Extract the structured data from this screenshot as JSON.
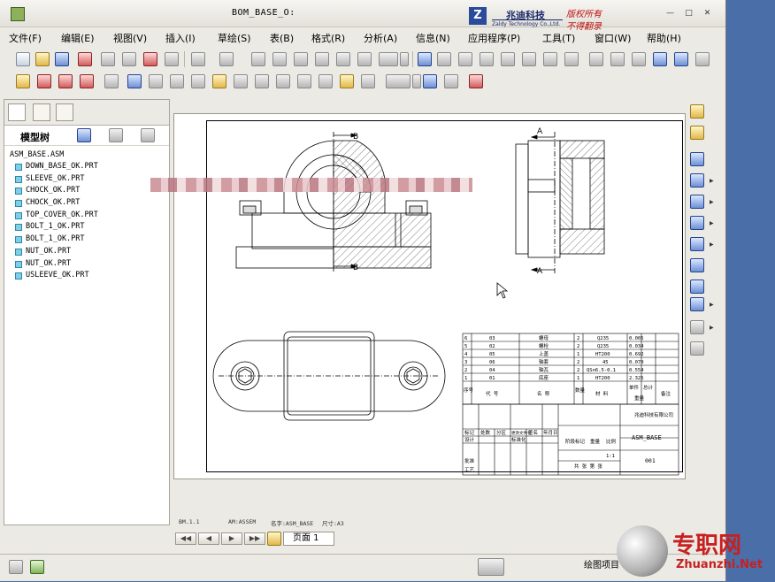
{
  "window": {
    "title": "BOM_BASE_O:",
    "minimize": "—",
    "maximize": "□",
    "close": "✕"
  },
  "watermark": {
    "logo": "Z",
    "name": "兆迪科技",
    "english": "Zaldy Technology Co.,Ltd.",
    "copyright": "版权所有",
    "no_copy": "不得翻录"
  },
  "menu": [
    {
      "label": "文件(F)"
    },
    {
      "label": "编辑(E)"
    },
    {
      "label": "视图(V)"
    },
    {
      "label": "插入(I)"
    },
    {
      "label": "草绘(S)"
    },
    {
      "label": "表(B)"
    },
    {
      "label": "格式(R)"
    },
    {
      "label": "分析(A)"
    },
    {
      "label": "信息(N)"
    },
    {
      "label": "应用程序(P)"
    },
    {
      "label": "工具(T)"
    },
    {
      "label": "窗口(W)"
    },
    {
      "label": "帮助(H)"
    }
  ],
  "model_tree": {
    "title": "模型树",
    "root": "ASM_BASE.ASM",
    "items": [
      "DOWN_BASE_OK.PRT",
      "SLEEVE_OK.PRT",
      "CHOCK_OK.PRT",
      "CHOCK_OK.PRT",
      "TOP_COVER_OK.PRT",
      "BOLT_1_OK.PRT",
      "BOLT_1_OK.PRT",
      "NUT_OK.PRT",
      "NUT_OK.PRT",
      "USLEEVE_OK.PRT"
    ]
  },
  "drawing": {
    "section_b": "B",
    "section_a": "A",
    "bom_rows": [
      {
        "no": "6",
        "code": "03",
        "name": "螺母",
        "qty": "2",
        "material": "Q235",
        "weight": "0.005"
      },
      {
        "no": "5",
        "code": "02",
        "name": "螺栓",
        "qty": "2",
        "material": "Q235",
        "weight": "0.034"
      },
      {
        "no": "4",
        "code": "05",
        "name": "上盖",
        "qty": "1",
        "material": "HT200",
        "weight": "0.692"
      },
      {
        "no": "3",
        "code": "06",
        "name": "轴套",
        "qty": "2",
        "material": "45",
        "weight": "0.070"
      },
      {
        "no": "2",
        "code": "04",
        "name": "轴瓦",
        "qty": "2",
        "material": "QSn6.5-0.1",
        "weight": "0.554"
      },
      {
        "no": "1",
        "code": "01",
        "name": "底座",
        "qty": "1",
        "material": "HT200",
        "weight": "2.325"
      }
    ],
    "bom_header": {
      "no": "序号",
      "code": "代 号",
      "name": "名 称",
      "qty": "数量",
      "material": "材 料",
      "unit_weight": "单件",
      "total_weight": "总计",
      "weight": "重量",
      "remark": "备注"
    },
    "title_block": {
      "company": "兆迪科技有限公司",
      "drawing_name": "ASM_BASE",
      "drawing_no": "001",
      "scale": "1:1",
      "sheets": "共  张 第  张",
      "labels": {
        "mark": "标记",
        "count": "处数",
        "zone": "分区",
        "change_doc": "更改文件号",
        "sign": "签名",
        "date": "年月日",
        "design": "设计",
        "standard": "标准化",
        "stage_mark": "阶段标记",
        "weight": "重量",
        "ratio": "比例",
        "approve": "批准",
        "process": "工艺"
      }
    }
  },
  "status": {
    "sheet_info": "BM.1.1",
    "type": "AM:ASSEM",
    "name": "名字:ASM_BASE",
    "size": "尺寸:A3"
  },
  "page_nav": {
    "first": "◀◀",
    "prev": "◀",
    "next": "▶",
    "last": "▶▶",
    "page_label": "页面 1"
  },
  "bottom": {
    "filter_label": "绘图项目"
  },
  "site": {
    "name": "专职网",
    "url": "Zhuanzhi.Net"
  }
}
